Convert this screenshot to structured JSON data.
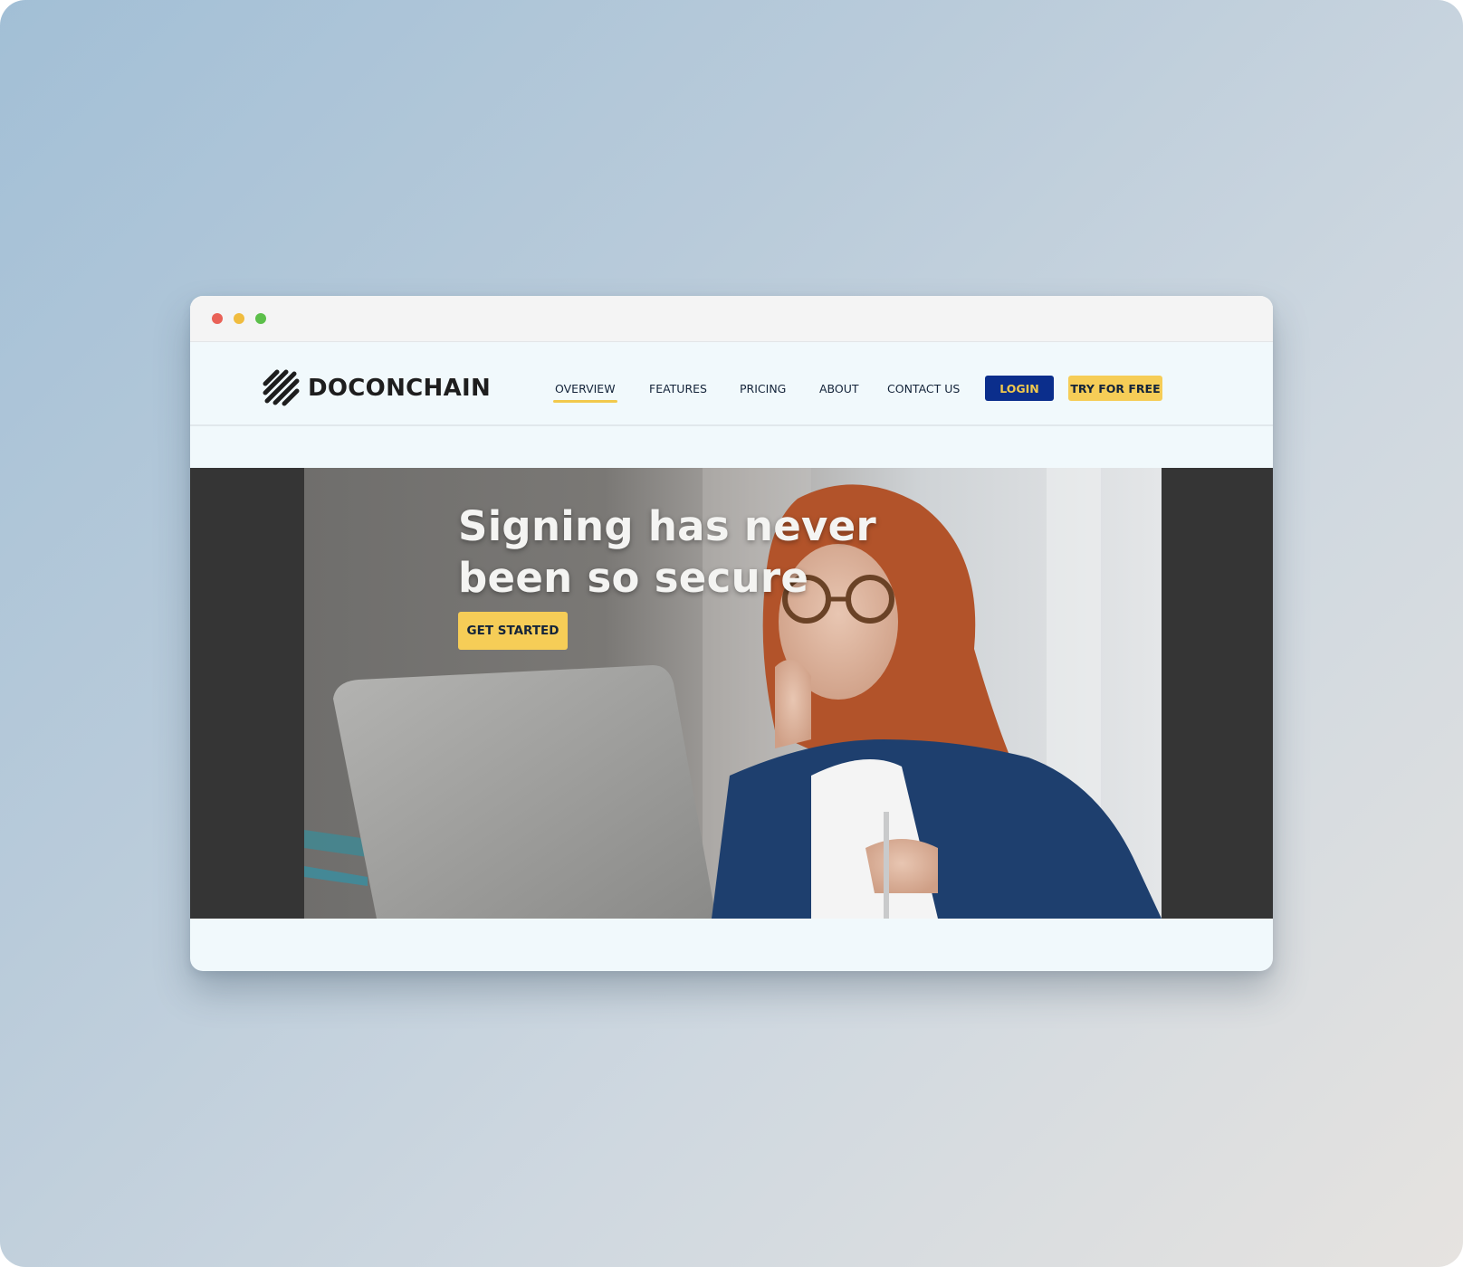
{
  "window": {
    "controls": [
      "close",
      "minimize",
      "maximize"
    ]
  },
  "header": {
    "logo_text": "DOCONCHAIN",
    "logo_icon": "striped-chain-logo-icon",
    "nav": [
      {
        "label": "OVERVIEW",
        "active": true
      },
      {
        "label": "FEATURES",
        "active": false
      },
      {
        "label": "PRICING",
        "active": false
      },
      {
        "label": "ABOUT",
        "active": false
      },
      {
        "label": "CONTACT US",
        "active": false
      }
    ],
    "login_label": "LOGIN",
    "try_label": "TRY FOR FREE"
  },
  "hero": {
    "title": "Signing has never\nbeen so secure",
    "cta_label": "GET STARTED"
  },
  "colors": {
    "accent_yellow": "#f6cd57",
    "brand_navy": "#0b2e8c",
    "text_dark": "#14243a",
    "hero_side": "#353535",
    "page_bg": "#f1f9fc"
  }
}
